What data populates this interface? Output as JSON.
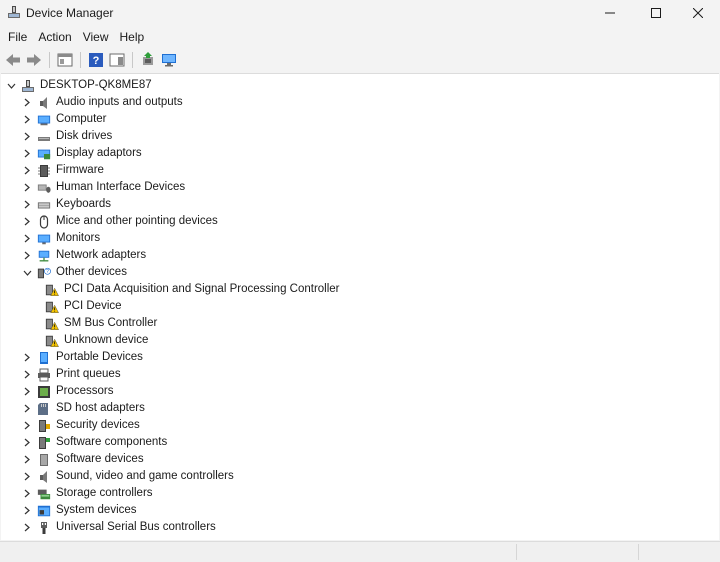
{
  "window": {
    "title": "Device Manager",
    "minimize_glyph": "—",
    "maximize_glyph": "☐",
    "close_glyph": "✕"
  },
  "menu": [
    "File",
    "Action",
    "View",
    "Help"
  ],
  "toolbar": {
    "buttons": [
      "back-arrow-icon",
      "forward-arrow-icon",
      "properties-icon",
      "help-icon",
      "action-pane-icon",
      "update-driver-icon",
      "monitor-scan-icon"
    ]
  },
  "tree": {
    "root": "DESKTOP-QK8ME87",
    "categories": [
      {
        "label": "Audio inputs and outputs",
        "icon": "speaker-icon",
        "expanded": false
      },
      {
        "label": "Computer",
        "icon": "computer-icon",
        "expanded": false
      },
      {
        "label": "Disk drives",
        "icon": "disk-drive-icon",
        "expanded": false
      },
      {
        "label": "Display adaptors",
        "icon": "display-adapter-icon",
        "expanded": false
      },
      {
        "label": "Firmware",
        "icon": "firmware-chip-icon",
        "expanded": false
      },
      {
        "label": "Human Interface Devices",
        "icon": "hid-icon",
        "expanded": false
      },
      {
        "label": "Keyboards",
        "icon": "keyboard-icon",
        "expanded": false
      },
      {
        "label": "Mice and other pointing devices",
        "icon": "mouse-icon",
        "expanded": false
      },
      {
        "label": "Monitors",
        "icon": "monitor-icon",
        "expanded": false
      },
      {
        "label": "Network adapters",
        "icon": "network-adapter-icon",
        "expanded": false
      },
      {
        "label": "Other devices",
        "icon": "unknown-device-icon",
        "expanded": true,
        "children": [
          {
            "label": "PCI Data Acquisition and Signal Processing Controller",
            "icon": "warning-device-icon"
          },
          {
            "label": "PCI Device",
            "icon": "warning-device-icon"
          },
          {
            "label": "SM Bus Controller",
            "icon": "warning-device-icon"
          },
          {
            "label": "Unknown device",
            "icon": "warning-device-icon"
          }
        ]
      },
      {
        "label": "Portable Devices",
        "icon": "portable-device-icon",
        "expanded": false
      },
      {
        "label": "Print queues",
        "icon": "printer-icon",
        "expanded": false
      },
      {
        "label": "Processors",
        "icon": "processor-icon",
        "expanded": false
      },
      {
        "label": "SD host adapters",
        "icon": "sd-card-icon",
        "expanded": false
      },
      {
        "label": "Security devices",
        "icon": "security-device-icon",
        "expanded": false
      },
      {
        "label": "Software components",
        "icon": "software-component-icon",
        "expanded": false
      },
      {
        "label": "Software devices",
        "icon": "software-device-icon",
        "expanded": false
      },
      {
        "label": "Sound, video and game controllers",
        "icon": "sound-controller-icon",
        "expanded": false
      },
      {
        "label": "Storage controllers",
        "icon": "storage-controller-icon",
        "expanded": false
      },
      {
        "label": "System devices",
        "icon": "system-device-icon",
        "expanded": false
      },
      {
        "label": "Universal Serial Bus controllers",
        "icon": "usb-icon",
        "expanded": false
      }
    ]
  },
  "colors": {
    "accent_blue": "#1f6fd1",
    "warning_yellow": "#f5c400",
    "chrome_bg": "#f3f3f3",
    "tree_bg": "#ffffff"
  }
}
